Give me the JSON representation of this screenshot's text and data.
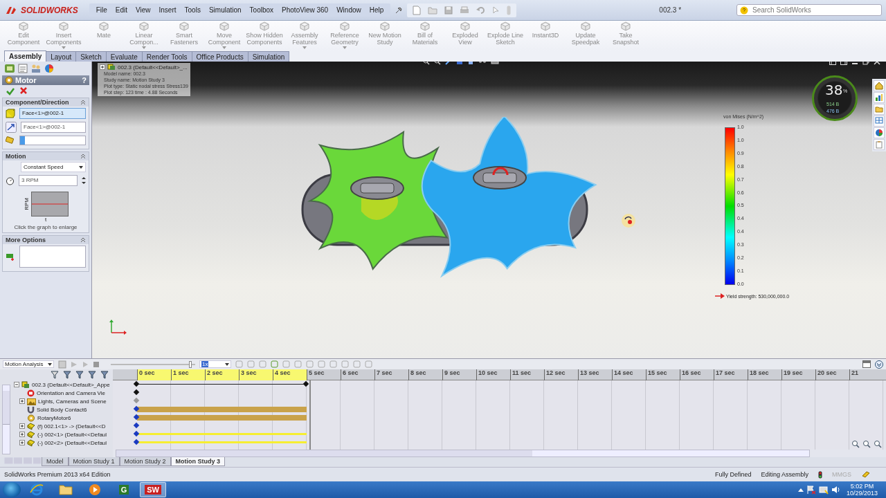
{
  "app": {
    "logo": "SOLIDWORKS",
    "menus": [
      "File",
      "Edit",
      "View",
      "Insert",
      "Tools",
      "Simulation",
      "Toolbox",
      "PhotoView 360",
      "Window",
      "Help"
    ],
    "title": "002.3 *",
    "search": {
      "placeholder": "Search SolidWorks"
    }
  },
  "commands": [
    {
      "label": "Edit Component",
      "dropdown": false
    },
    {
      "label": "Insert Components",
      "dropdown": true
    },
    {
      "label": "Mate",
      "dropdown": false
    },
    {
      "label": "Linear Compon...",
      "dropdown": true
    },
    {
      "label": "Smart Fasteners",
      "dropdown": false
    },
    {
      "label": "Move Component",
      "dropdown": true
    },
    {
      "label": "Show Hidden Components",
      "dropdown": false
    },
    {
      "label": "Assembly Features",
      "dropdown": true
    },
    {
      "label": "Reference Geometry",
      "dropdown": true
    },
    {
      "label": "New Motion Study",
      "dropdown": false
    },
    {
      "label": "Bill of Materials",
      "dropdown": false
    },
    {
      "label": "Exploded View",
      "dropdown": false
    },
    {
      "label": "Explode Line Sketch",
      "dropdown": false
    },
    {
      "label": "Instant3D",
      "dropdown": false
    },
    {
      "label": "Update Speedpak",
      "dropdown": false
    },
    {
      "label": "Take Snapshot",
      "dropdown": false
    }
  ],
  "tabs": [
    {
      "label": "Assembly",
      "selected": true
    },
    {
      "label": "Layout",
      "selected": false
    },
    {
      "label": "Sketch",
      "selected": false
    },
    {
      "label": "Evaluate",
      "selected": false
    },
    {
      "label": "Render Tools",
      "selected": false
    },
    {
      "label": "Office Products",
      "selected": false
    },
    {
      "label": "Simulation",
      "selected": false
    }
  ],
  "property_manager": {
    "title": "Motor",
    "help": "?",
    "component_direction": {
      "title": "Component/Direction",
      "expanded": true,
      "fields": [
        {
          "value": "Face<1>@002-1",
          "selected": true
        },
        {
          "value": "Face<1>@002-1",
          "selected": false
        }
      ]
    },
    "motion": {
      "title": "Motion",
      "expanded": true,
      "type": "Constant Speed",
      "speed": "3 RPM",
      "graph_ylabel": "RPM",
      "graph_xlabel": "t",
      "caption": "Click the graph to enlarge"
    },
    "more_options": {
      "title": "More Options",
      "expanded": true
    }
  },
  "viewport": {
    "tree_label": "002.3  (Default<<Default>_...",
    "plot_info": [
      "Model name: 002.3",
      "Study name: Motion Study 3",
      "Plot type: Static nodal stress Stress139",
      "Plot step: 123   time : 4.88 Seconds"
    ],
    "meter": {
      "value": "38",
      "unit": "%",
      "up": "514 B",
      "down": "476 B"
    },
    "legend": {
      "title": "von Mises (N/m^2)",
      "ticks": [
        "1.0",
        "1.0",
        "0.9",
        "0.8",
        "0.7",
        "0.6",
        "0.5",
        "0.4",
        "0.4",
        "0.3",
        "0.2",
        "0.1",
        "0.0"
      ],
      "yield": "Yield strength: 530,000,000.0"
    },
    "task_pane": [
      {
        "kind": "home"
      },
      {
        "kind": "chart"
      },
      {
        "kind": "folder"
      },
      {
        "kind": "table"
      },
      {
        "kind": "globe"
      },
      {
        "kind": "clipboard"
      }
    ]
  },
  "timeline": {
    "study_type": "Motion Analysis",
    "slider": {
      "level": 0.96
    },
    "speed": "1x",
    "ruler": [
      {
        "label": "0 sec",
        "selected": true
      },
      {
        "label": "1 sec",
        "selected": true
      },
      {
        "label": "2 sec",
        "selected": true
      },
      {
        "label": "3 sec",
        "selected": true
      },
      {
        "label": "4 sec",
        "selected": true
      },
      {
        "label": "5 sec",
        "selected": false
      },
      {
        "label": "6 sec",
        "selected": false
      },
      {
        "label": "7 sec",
        "selected": false
      },
      {
        "label": "8 sec",
        "selected": false
      },
      {
        "label": "9 sec",
        "selected": false
      },
      {
        "label": "10 sec",
        "selected": false
      },
      {
        "label": "11 sec",
        "selected": false
      },
      {
        "label": "12 sec",
        "selected": false
      },
      {
        "label": "13 sec",
        "selected": false
      },
      {
        "label": "14 sec",
        "selected": false
      },
      {
        "label": "15 sec",
        "selected": false
      },
      {
        "label": "16 sec",
        "selected": false
      },
      {
        "label": "17 sec",
        "selected": false
      },
      {
        "label": "18 sec",
        "selected": false
      },
      {
        "label": "19 sec",
        "selected": false
      },
      {
        "label": "20 sec",
        "selected": false
      },
      {
        "label": "21",
        "selected": false
      }
    ],
    "tree": {
      "label": "002.3  (Default<<Default>_Appe",
      "kind": "assembly",
      "expanded": true,
      "track": {
        "kind": "line"
      },
      "children": [
        {
          "label": "Orientation and Camera Vie",
          "kind": "orientation",
          "track": {
            "kind": "key"
          }
        },
        {
          "label": "Lights, Cameras and Scene",
          "kind": "lights",
          "expanded": false,
          "track": {
            "kind": "faded"
          }
        },
        {
          "label": "Solid Body Contact6",
          "kind": "contact",
          "track": {
            "kind": "bar"
          }
        },
        {
          "label": "RotaryMotor6",
          "kind": "motor",
          "track": {
            "kind": "bar"
          }
        },
        {
          "label": "(f) 002.1<1> -> (Default<<D",
          "kind": "part",
          "expanded": false,
          "track": {
            "kind": "marker"
          }
        },
        {
          "label": "(-) 002<1> (Default<<Defaul",
          "kind": "part",
          "expanded": false,
          "track": {
            "kind": "thin"
          }
        },
        {
          "label": "(-) 002<2> (Default<<Defaul",
          "kind": "part",
          "expanded": false,
          "track": {
            "kind": "thin"
          }
        }
      ]
    }
  },
  "study_tabs": [
    {
      "label": "Model",
      "selected": false
    },
    {
      "label": "Motion Study 1",
      "selected": false
    },
    {
      "label": "Motion Study 2",
      "selected": false
    },
    {
      "label": "Motion Study 3",
      "selected": true
    }
  ],
  "status_bar": {
    "edition": "SolidWorks Premium 2013 x64 Edition",
    "state": "Fully Defined",
    "mode": "Editing Assembly",
    "units": "MMGS"
  },
  "taskbar": {
    "apps": [
      {
        "kind": "browser",
        "active": false
      },
      {
        "kind": "folder",
        "active": false
      },
      {
        "kind": "media",
        "active": false
      },
      {
        "kind": "app",
        "label": "G",
        "active": false
      },
      {
        "kind": "app",
        "label": "SW",
        "active": true
      }
    ],
    "time": "5:02 PM",
    "date": "10/29/2013"
  }
}
